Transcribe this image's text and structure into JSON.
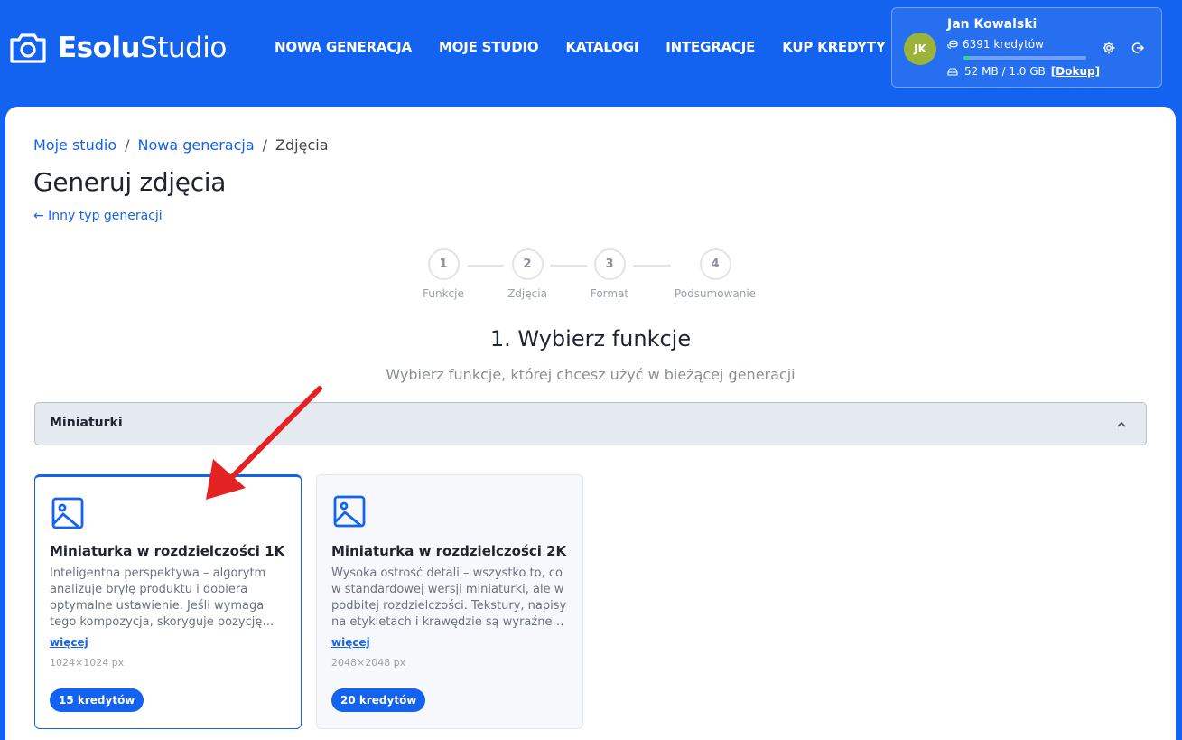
{
  "header": {
    "brand_bold": "Esolu",
    "brand_light": "Studio",
    "nav": [
      "NOWA GENERACJA",
      "MOJE STUDIO",
      "KATALOGI",
      "INTEGRACJE",
      "KUP KREDYTY"
    ],
    "user": {
      "initials": "JK",
      "name": "Jan Kowalski",
      "credits": "6391 kredytów",
      "storage": "52 MB / 1.0 GB",
      "storage_fraction": 0.05,
      "topup": "[Dokup]"
    }
  },
  "breadcrumb": {
    "items": [
      "Moje studio",
      "Nowa generacja"
    ],
    "current": "Zdjęcia",
    "sep": "/"
  },
  "page": {
    "title": "Generuj zdjęcia",
    "back": "← Inny typ generacji"
  },
  "stepper": {
    "steps": [
      {
        "num": "1",
        "label": "Funkcje"
      },
      {
        "num": "2",
        "label": "Zdjęcia"
      },
      {
        "num": "3",
        "label": "Format"
      },
      {
        "num": "4",
        "label": "Podsumowanie"
      }
    ],
    "active_index": 0
  },
  "section": {
    "title": "1. Wybierz funkcje",
    "subtitle": "Wybierz funkcje, której chcesz użyć w bieżącej generacji"
  },
  "accordion": {
    "title": "Miniaturki",
    "icon": "chevron-up-icon"
  },
  "cards": [
    {
      "title": "Miniaturka w rozdzielczości 1K",
      "desc": "Inteligentna perspektywa – algorytm analizuje bryłę produktu i dobiera optymalne ustawienie. Jeśli wymaga tego kompozycja, skoryguje pozycję…",
      "more": "więcej",
      "resolution": "1024×1024 px",
      "price": "15 kredytów",
      "selected": true
    },
    {
      "title": "Miniaturka w rozdzielczości 2K",
      "desc": "Wysoka ostrość detali – wszystko to, co w standardowej wersji miniaturki, ale w podbitej rozdzielczości. Tekstury, napisy na etykietach i krawędzie są wyraźne i…",
      "more": "więcej",
      "resolution": "2048×2048 px",
      "price": "20 kredytów",
      "selected": false
    }
  ],
  "colors": {
    "primary": "#1463f0",
    "avatar": "#9cb33a",
    "annotation_arrow": "#e32323"
  }
}
